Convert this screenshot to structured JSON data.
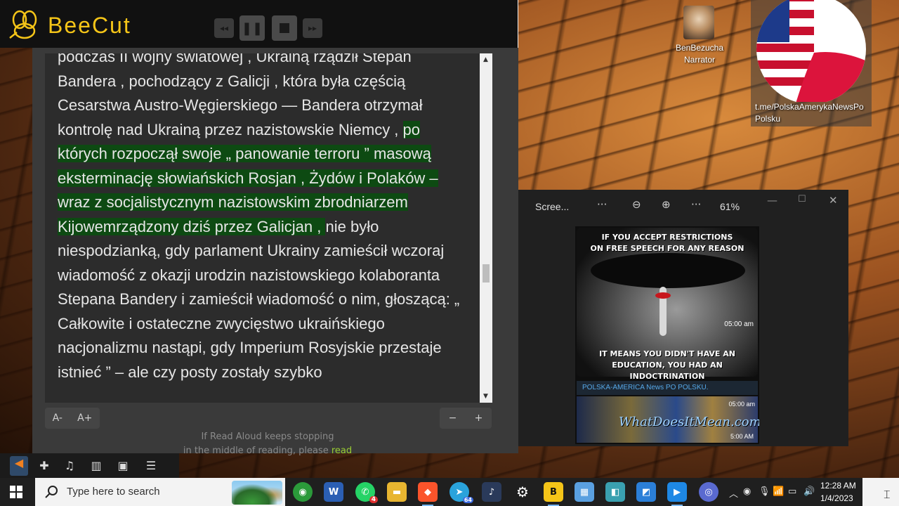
{
  "recorder": {
    "app_name": "BeeCut",
    "buttons": [
      "rewind",
      "pause",
      "stop",
      "forward"
    ]
  },
  "reader": {
    "text_before_highlight": "podczas II wojny światowej , Ukrainą rządził Stepan Bandera , pochodzący z Galicji , która była częścią Cesarstwa Austro-Węgierskiego — Bandera otrzymał kontrolę nad Ukrainą przez nazistowskie Niemcy , ",
    "text_highlight": "po których rozpoczął swoje „ panowanie terroru ” masową eksterminację słowiańskich Rosjan , Żydów i Polaków – wraz z socjalistycznym nazistowskim zbrodniarzem Kijowemrządzony dziś przez Galicjan , ",
    "text_after_highlight": "nie było niespodzianką, gdy parlament Ukrainy zamieścił wczoraj wiadomość z okazji urodzin nazistowskiego kolaboranta Stepana Bandery i zamieścił wiadomość o nim, głoszącą: „ Całkowite i ostateczne zwycięstwo ukraińskiego nacjonalizmu nastąpi, gdy Imperium Rosyjskie przestaje istnieć ” – ale czy posty zostały szybko",
    "font_decrease": "A-",
    "font_increase": "A+",
    "speed_decrease": "−",
    "speed_increase": "+",
    "note_line1": "If Read Aloud keeps stopping",
    "note_line2": "in the middle of reading, please",
    "note_link": "read"
  },
  "desktop": {
    "icon1_label_line1": "BenBezucha",
    "icon1_label_line2": "Narrator",
    "icon2_label_line1": "t.me/PolskaAmerykaNewsPo",
    "icon2_label_line2": "Polsku"
  },
  "viewer": {
    "title": "Scree...",
    "zoom": "61%",
    "meme_top_line1": "IF YOU ACCEPT RESTRICTIONS",
    "meme_top_line2": "ON FREE SPEECH FOR ANY REASON",
    "meme_bottom_line1": "IT MEANS YOU DIDN'T HAVE AN",
    "meme_bottom_line2": "EDUCATION, YOU HAD AN INDOCTRINATION",
    "meme_time": "05:00 am",
    "channel_name": "POLSKA-AMERICA News PO POLSKU.",
    "thumb_text": "WhatDoesItMean.com",
    "thumb_time1": "05:00 am",
    "thumb_time2": "5:00 AM"
  },
  "taskbar": {
    "search_placeholder": "Type here to search",
    "time": "12:28 AM",
    "date": "1/4/2023",
    "whatsapp_badge": "4",
    "telegram_badge": "64"
  },
  "colors": {
    "highlight": "#0d4a12",
    "brand": "#f5c518"
  }
}
